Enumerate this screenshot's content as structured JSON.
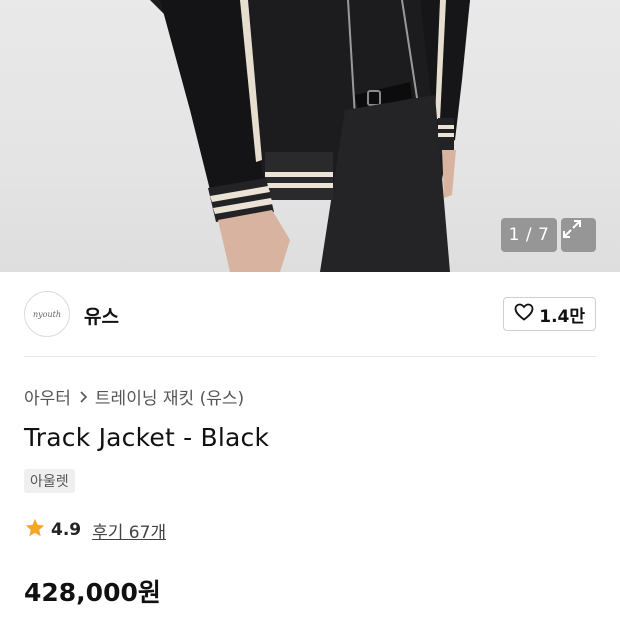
{
  "gallery": {
    "counter": "1 / 7",
    "expand_icon": "expand-icon"
  },
  "brand": {
    "logo_text": "nyouth",
    "name": "유스"
  },
  "like": {
    "icon": "heart-icon",
    "count": "1.4만"
  },
  "breadcrumb": {
    "items": [
      "아우터",
      "트레이닝 재킷 (유스)"
    ],
    "separator_icon": "chevron-right-icon"
  },
  "product": {
    "title": "Track Jacket - Black",
    "tag": "아울렛",
    "rating": "4.9",
    "reviews_label": "후기 67개",
    "price": "428,000원"
  },
  "colors": {
    "star": "#f5a623",
    "text": "#111111",
    "muted": "#555555",
    "tag_bg": "#efefef"
  }
}
